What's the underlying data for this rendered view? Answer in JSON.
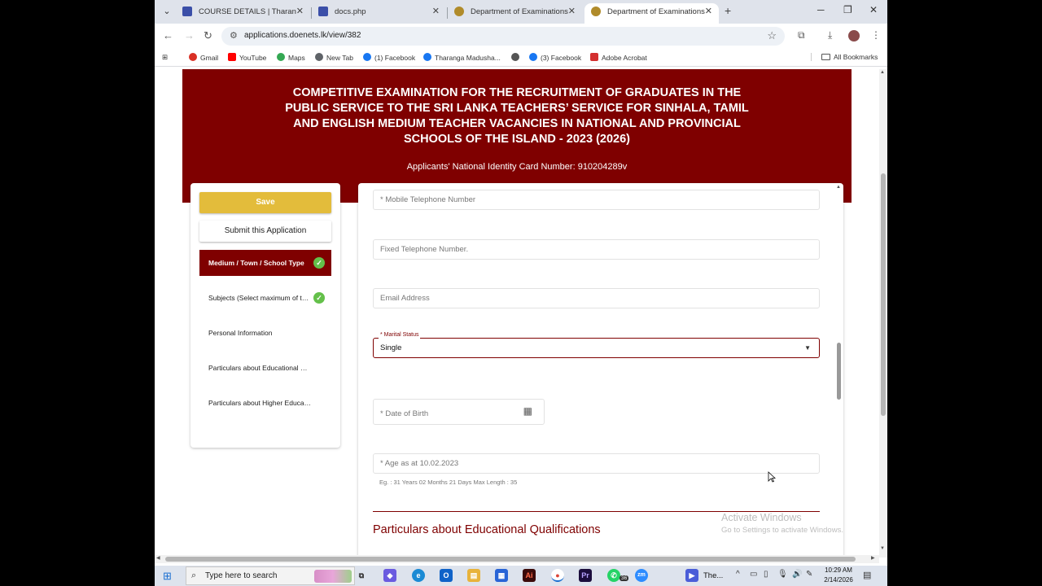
{
  "browser": {
    "tabs": [
      {
        "title": "COURSE DETAILS | Tharanga G",
        "color": "#3b4fa8"
      },
      {
        "title": "docs.php",
        "color": "#3b4fa8"
      },
      {
        "title": "Department of Examinations - S",
        "color": "#b08b2a"
      },
      {
        "title": "Department of Examinations - S",
        "color": "#b08b2a",
        "active": true
      }
    ],
    "url": "applications.doenets.lk/view/382",
    "bookmarks": [
      {
        "label": "Gmail",
        "color": "#d93025"
      },
      {
        "label": "YouTube",
        "color": "#ff0000"
      },
      {
        "label": "Maps",
        "color": "#34a853"
      },
      {
        "label": "New Tab",
        "color": "#5f6368"
      },
      {
        "label": "(1) Facebook",
        "color": "#1877f2"
      },
      {
        "label": "Tharanga Madusha...",
        "color": "#1877f2"
      },
      {
        "label": "",
        "color": "#555555"
      },
      {
        "label": "(3) Facebook",
        "color": "#1877f2"
      },
      {
        "label": "Adobe Acrobat",
        "color": "#d32f2f"
      }
    ],
    "all_bookmarks": "All Bookmarks"
  },
  "page": {
    "banner_title": "COMPETITIVE EXAMINATION FOR THE RECRUITMENT OF GRADUATES IN THE PUBLIC SERVICE TO THE SRI LANKA TEACHERS’ SERVICE FOR SINHALA, TAMIL AND ENGLISH MEDIUM TEACHER VACANCIES IN NATIONAL AND PROVINCIAL SCHOOLS OF THE ISLAND - 2023 (2026)",
    "nic_line": "Applicants' National Identity Card Number: 910204289v",
    "save_label": "Save",
    "submit_label": "Submit this Application",
    "steps": [
      {
        "label": "Medium / Town / School Type",
        "done": true
      },
      {
        "label": "Subjects (Select maximum of two subjects)",
        "done": true
      },
      {
        "label": "Personal Information",
        "done": false
      },
      {
        "label": "Particulars about Educational Qualifications",
        "done": false
      },
      {
        "label": "Particulars about Higher Education",
        "done": false
      }
    ],
    "form": {
      "mobile_placeholder": "* Mobile Telephone Number",
      "fixed_placeholder": "Fixed Telephone Number.",
      "email_placeholder": "Email Address",
      "marital_label": "* Marital Status",
      "marital_value": "Single",
      "dob_placeholder": "* Date of Birth",
      "age_placeholder": "* Age as at 10.02.2023",
      "age_hint": "Eg. : 31 Years 02 Months 21 Days Max Length : 35",
      "section_heading": "Particulars about Educational Qualifications"
    },
    "watermark": {
      "line1": "Activate Windows",
      "line2": "Go to Settings to activate Windows."
    },
    "colors": {
      "brand": "#7f0000",
      "save": "#e3bc3b",
      "check": "#64c04a"
    }
  },
  "taskbar": {
    "search_placeholder": "Type here to search",
    "badge": "36",
    "active_label": "The...",
    "time": "10:29 AM",
    "date": "2/14/2026"
  }
}
